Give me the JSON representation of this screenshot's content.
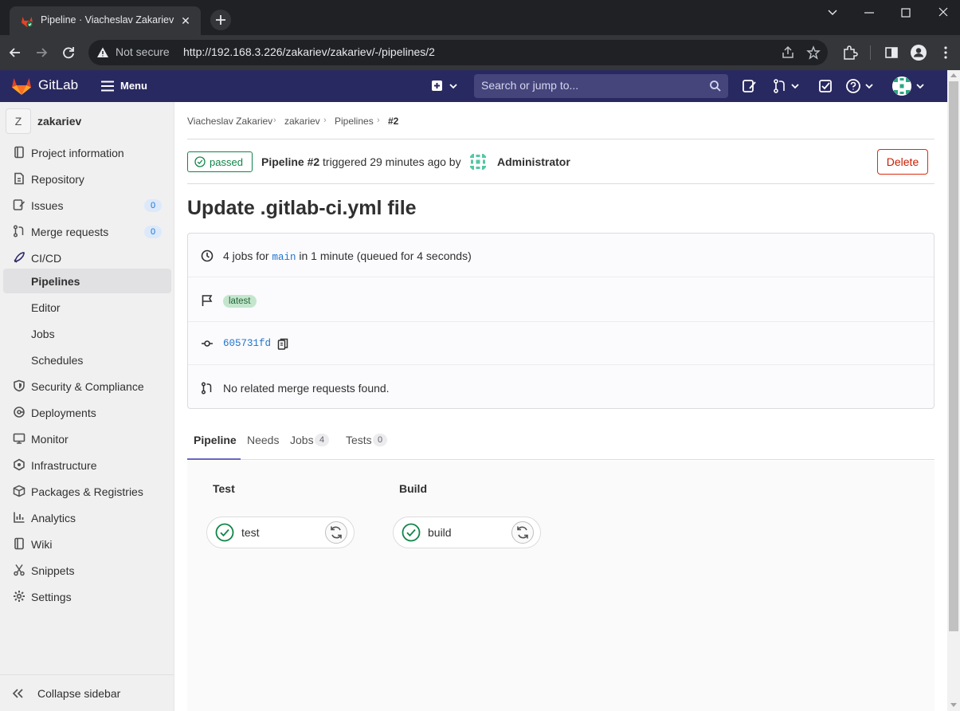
{
  "browser": {
    "tab_title": "Pipeline · Viacheslav Zakariev / z",
    "security_label": "Not secure",
    "url": "http://192.168.3.226/zakariev/zakariev/-/pipelines/2"
  },
  "topnav": {
    "brand": "GitLab",
    "menu_label": "Menu",
    "search_placeholder": "Search or jump to..."
  },
  "sidebar": {
    "project_initial": "Z",
    "project_name": "zakariev",
    "items": [
      {
        "label": "Project information",
        "icon": "project-info-icon"
      },
      {
        "label": "Repository",
        "icon": "repository-icon"
      },
      {
        "label": "Issues",
        "icon": "issues-icon",
        "count": "0"
      },
      {
        "label": "Merge requests",
        "icon": "merge-request-icon",
        "count": "0"
      },
      {
        "label": "CI/CD",
        "icon": "rocket-icon"
      },
      {
        "label": "Pipelines"
      },
      {
        "label": "Editor"
      },
      {
        "label": "Jobs"
      },
      {
        "label": "Schedules"
      },
      {
        "label": "Security & Compliance",
        "icon": "shield-icon"
      },
      {
        "label": "Deployments",
        "icon": "deployments-icon"
      },
      {
        "label": "Monitor",
        "icon": "monitor-icon"
      },
      {
        "label": "Infrastructure",
        "icon": "infrastructure-icon"
      },
      {
        "label": "Packages & Registries",
        "icon": "package-icon"
      },
      {
        "label": "Analytics",
        "icon": "analytics-icon"
      },
      {
        "label": "Wiki",
        "icon": "book-icon"
      },
      {
        "label": "Snippets",
        "icon": "snippet-icon"
      },
      {
        "label": "Settings",
        "icon": "gear-icon"
      }
    ],
    "collapse_label": "Collapse sidebar"
  },
  "breadcrumb": [
    "Viacheslav Zakariev",
    "zakariev",
    "Pipelines",
    "#2"
  ],
  "header": {
    "status": "passed",
    "pipeline_label": "Pipeline #2",
    "triggered_text": "triggered 29 minutes ago by",
    "user": "Administrator",
    "delete_label": "Delete"
  },
  "title": "Update .gitlab-ci.yml file",
  "info": {
    "jobs_prefix": "4 jobs for",
    "branch": "main",
    "jobs_suffix": "in 1 minute (queued for 4 seconds)",
    "badge": "latest",
    "commit_sha": "605731fd",
    "merge_text": "No related merge requests found."
  },
  "tabs": [
    {
      "label": "Pipeline"
    },
    {
      "label": "Needs"
    },
    {
      "label": "Jobs",
      "count": "4"
    },
    {
      "label": "Tests",
      "count": "0"
    }
  ],
  "stages": [
    {
      "title": "Test",
      "job": "test"
    },
    {
      "title": "Build",
      "job": "build"
    }
  ],
  "colors": {
    "navbar": "#292961",
    "success": "#108548",
    "danger": "#dd2b0e",
    "link": "#1f75cb"
  }
}
